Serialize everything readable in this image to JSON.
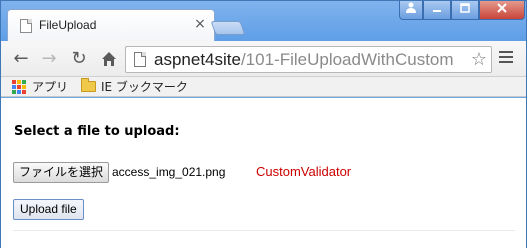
{
  "browser": {
    "tab_title": "FileUpload",
    "url_host": "aspnet4site",
    "url_path": "/101-FileUploadWithCustom"
  },
  "bookmarks": {
    "apps_label": "アプリ",
    "folder_label": "IE ブックマーク"
  },
  "page": {
    "heading": "Select a file to upload:",
    "file_button_label": "ファイルを選択",
    "file_name": "access_img_021.png",
    "validator_text": "CustomValidator",
    "upload_button_label": "Upload file"
  },
  "colors": {
    "validator": "#cc0000",
    "titlebar": "#6aa6e8"
  },
  "icons": [
    "tab-page-icon",
    "tab-close-icon",
    "user-icon",
    "minimize-icon",
    "maximize-icon",
    "close-icon",
    "back-arrow-icon",
    "forward-arrow-icon",
    "reload-icon",
    "home-icon",
    "page-icon",
    "star-icon",
    "menu-icon",
    "apps-icon",
    "folder-icon"
  ]
}
